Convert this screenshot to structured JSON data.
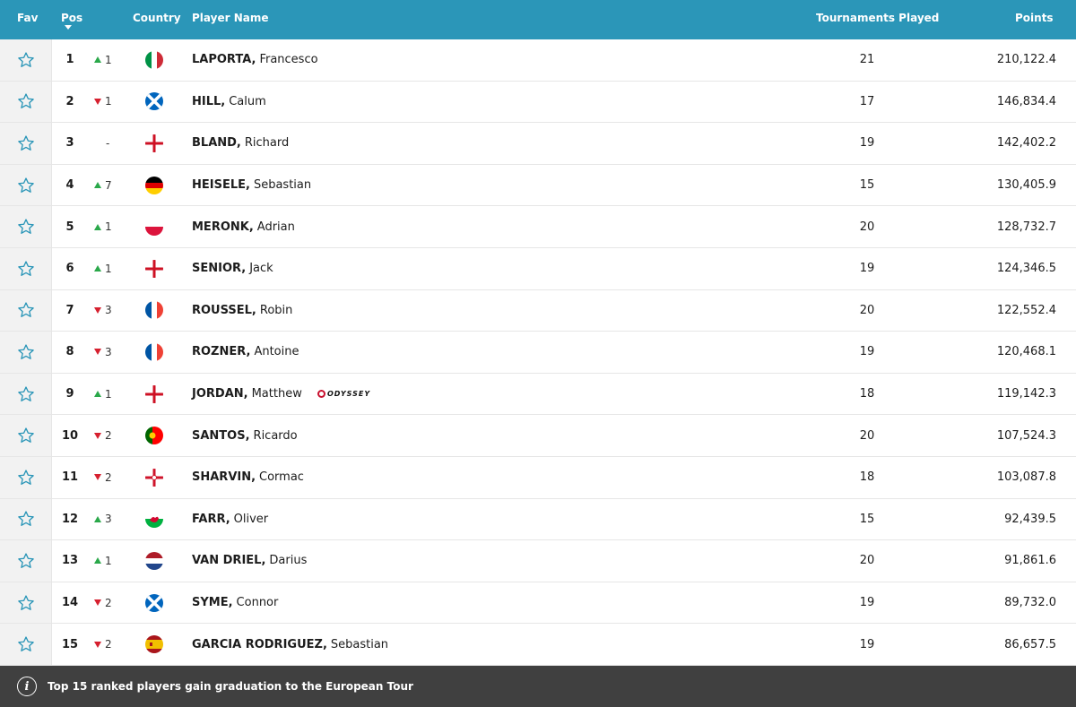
{
  "header": {
    "fav": "Fav",
    "pos": "Pos",
    "country": "Country",
    "player_name": "Player Name",
    "tournaments_played": "Tournaments Played",
    "points": "Points"
  },
  "colors": {
    "header_bg": "#2b96b8",
    "footer_bg": "#404040",
    "up": "#2aa84a",
    "down": "#d6202f",
    "star": "#2b96b8"
  },
  "rows": [
    {
      "pos": "1",
      "move_dir": "up",
      "move": "1",
      "country": "italy",
      "surname": "LAPORTA,",
      "given": "Francesco",
      "sponsor": "",
      "tp": "21",
      "points": "210,122.4"
    },
    {
      "pos": "2",
      "move_dir": "down",
      "move": "1",
      "country": "scotland",
      "surname": "HILL,",
      "given": "Calum",
      "sponsor": "",
      "tp": "17",
      "points": "146,834.4"
    },
    {
      "pos": "3",
      "move_dir": "none",
      "move": "-",
      "country": "england",
      "surname": "BLAND,",
      "given": "Richard",
      "sponsor": "",
      "tp": "19",
      "points": "142,402.2"
    },
    {
      "pos": "4",
      "move_dir": "up",
      "move": "7",
      "country": "germany",
      "surname": "HEISELE,",
      "given": "Sebastian",
      "sponsor": "",
      "tp": "15",
      "points": "130,405.9"
    },
    {
      "pos": "5",
      "move_dir": "up",
      "move": "1",
      "country": "poland",
      "surname": "MERONK,",
      "given": "Adrian",
      "sponsor": "",
      "tp": "20",
      "points": "128,732.7"
    },
    {
      "pos": "6",
      "move_dir": "up",
      "move": "1",
      "country": "england",
      "surname": "SENIOR,",
      "given": "Jack",
      "sponsor": "",
      "tp": "19",
      "points": "124,346.5"
    },
    {
      "pos": "7",
      "move_dir": "down",
      "move": "3",
      "country": "france",
      "surname": "ROUSSEL,",
      "given": "Robin",
      "sponsor": "",
      "tp": "20",
      "points": "122,552.4"
    },
    {
      "pos": "8",
      "move_dir": "down",
      "move": "3",
      "country": "france",
      "surname": "ROZNER,",
      "given": "Antoine",
      "sponsor": "",
      "tp": "19",
      "points": "120,468.1"
    },
    {
      "pos": "9",
      "move_dir": "up",
      "move": "1",
      "country": "england",
      "surname": "JORDAN,",
      "given": "Matthew",
      "sponsor": "ODYSSEY",
      "tp": "18",
      "points": "119,142.3"
    },
    {
      "pos": "10",
      "move_dir": "down",
      "move": "2",
      "country": "portugal",
      "surname": "SANTOS,",
      "given": "Ricardo",
      "sponsor": "",
      "tp": "20",
      "points": "107,524.3"
    },
    {
      "pos": "11",
      "move_dir": "down",
      "move": "2",
      "country": "northern-ireland",
      "surname": "SHARVIN,",
      "given": "Cormac",
      "sponsor": "",
      "tp": "18",
      "points": "103,087.8"
    },
    {
      "pos": "12",
      "move_dir": "up",
      "move": "3",
      "country": "wales",
      "surname": "FARR,",
      "given": "Oliver",
      "sponsor": "",
      "tp": "15",
      "points": "92,439.5"
    },
    {
      "pos": "13",
      "move_dir": "up",
      "move": "1",
      "country": "netherlands",
      "surname": "VAN DRIEL,",
      "given": "Darius",
      "sponsor": "",
      "tp": "20",
      "points": "91,861.6"
    },
    {
      "pos": "14",
      "move_dir": "down",
      "move": "2",
      "country": "scotland",
      "surname": "SYME,",
      "given": "Connor",
      "sponsor": "",
      "tp": "19",
      "points": "89,732.0"
    },
    {
      "pos": "15",
      "move_dir": "down",
      "move": "2",
      "country": "spain",
      "surname": "GARCIA RODRIGUEZ,",
      "given": "Sebastian",
      "sponsor": "",
      "tp": "19",
      "points": "86,657.5"
    }
  ],
  "footer": {
    "icon": "info-icon",
    "note": "Top 15 ranked players gain graduation to the European Tour"
  }
}
